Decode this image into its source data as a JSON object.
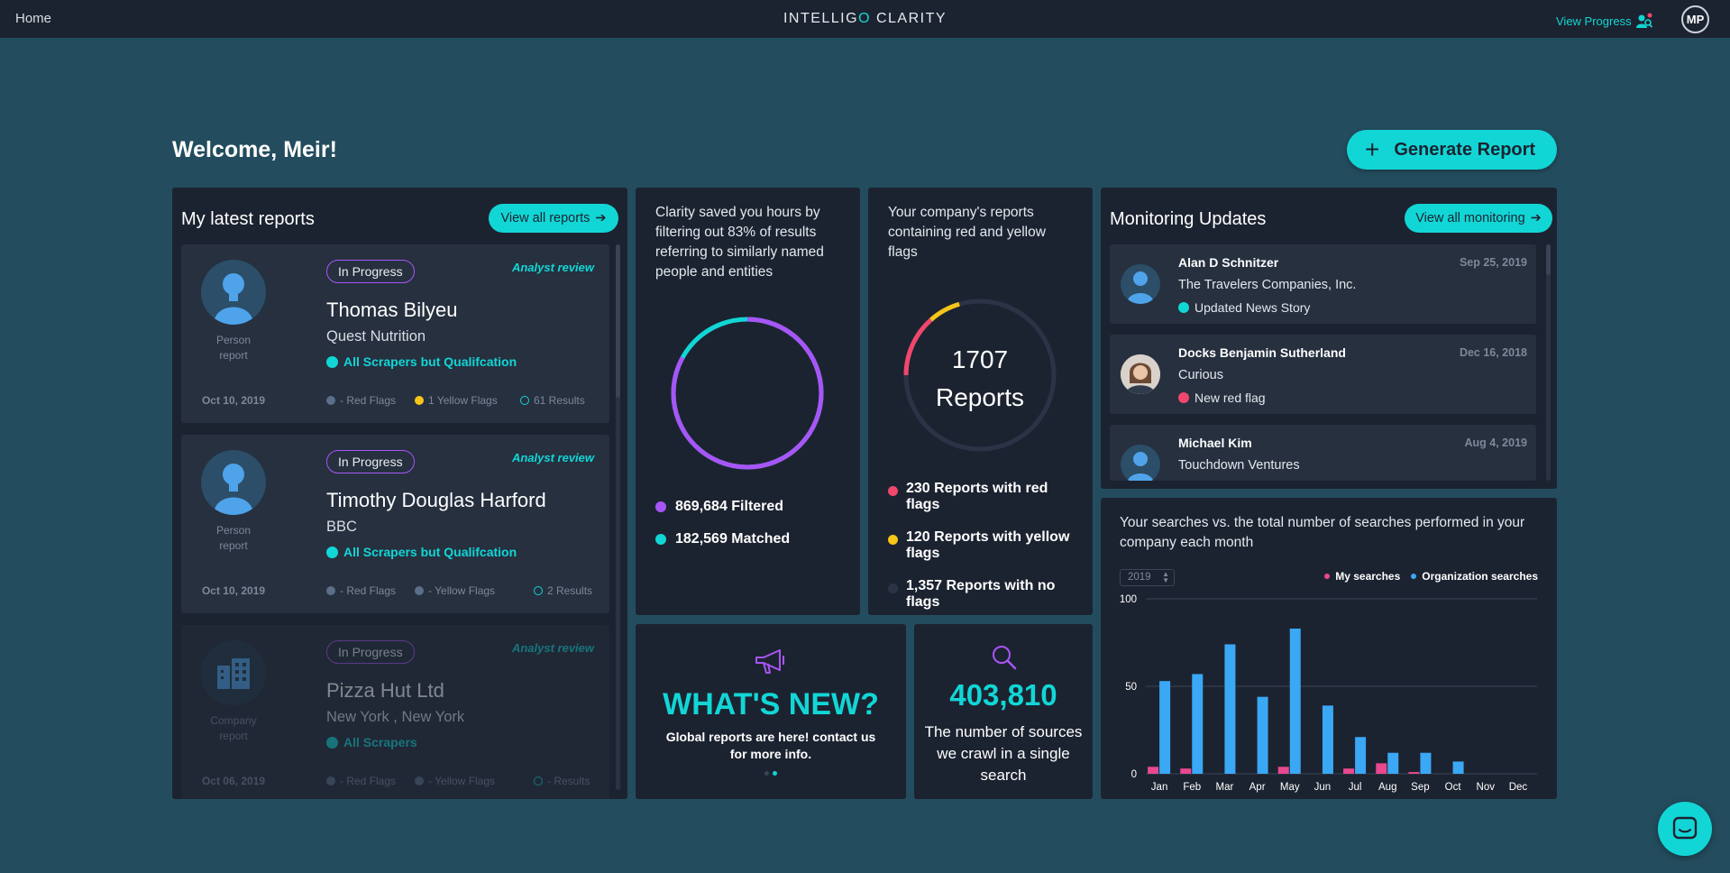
{
  "topbar": {
    "home": "Home",
    "brand_left": "INTELLIG",
    "brand_accent": "O",
    "brand_right": " CLARITY",
    "view_progress": "View Progress",
    "avatar_initials": "MP"
  },
  "welcome": "Welcome, Meir!",
  "generate_button": "Generate Report",
  "reports": {
    "title": "My latest reports",
    "view_all": "View all reports",
    "items": [
      {
        "status": "In Progress",
        "review": "Analyst review",
        "name": "Thomas Bilyeu",
        "company": "Quest Nutrition",
        "scraper": "All Scrapers but Qualifcation",
        "type_line1": "Person",
        "type_line2": "report",
        "date": "Oct 10, 2019",
        "red": "- Red Flags",
        "yellow": "1 Yellow Flags",
        "results": "61 Results"
      },
      {
        "status": "In Progress",
        "review": "Analyst review",
        "name": "Timothy Douglas Harford",
        "company": "BBC",
        "scraper": "All Scrapers but Qualifcation",
        "type_line1": "Person",
        "type_line2": "report",
        "date": "Oct 10, 2019",
        "red": "- Red Flags",
        "yellow": "- Yellow Flags",
        "results": "2 Results"
      },
      {
        "status": "In Progress",
        "review": "Analyst review",
        "name": "Pizza Hut Ltd",
        "company": "New York , New York",
        "scraper": "All Scrapers",
        "type_line1": "Company",
        "type_line2": "report",
        "date": "Oct 06, 2019",
        "red": "- Red Flags",
        "yellow": "- Yellow Flags",
        "results": "- Results"
      }
    ]
  },
  "saved": {
    "text": "Clarity saved you hours by filtering out 83% of results referring to similarly named people and entities",
    "filtered_pct": 83,
    "filtered": "869,684 Filtered",
    "matched": "182,569 Matched",
    "colors": {
      "filtered": "#a855f7",
      "matched": "#12d6d6"
    }
  },
  "flags": {
    "text": "Your company's reports containing red and yellow flags",
    "total": "1707",
    "total_label": "Reports",
    "red_count": 230,
    "yellow_count": 120,
    "none_count": 1357,
    "red_line1": "230 Reports with red",
    "red_line2": "flags",
    "yellow_line1": "120 Reports with yellow",
    "yellow_line2": "flags",
    "none_line1": "1,357 Reports with no",
    "none_line2": "flags",
    "colors": {
      "red": "#f0476d",
      "yellow": "#f5c518",
      "none": "#2a3446"
    }
  },
  "monitoring": {
    "title": "Monitoring Updates",
    "view_all": "View all monitoring",
    "items": [
      {
        "name": "Alan D Schnitzer",
        "date": "Sep 25, 2019",
        "sub": "The Travelers Companies, Inc.",
        "update": "Updated News Story",
        "update_icon": "news-icon"
      },
      {
        "name": "Docks Benjamin Sutherland",
        "date": "Dec 16, 2018",
        "sub": "Curious",
        "update": "New red flag",
        "update_icon": "flag-icon"
      },
      {
        "name": "Michael Kim",
        "date": "Aug 4, 2019",
        "sub": "Touchdown Ventures",
        "update": "",
        "update_icon": ""
      }
    ]
  },
  "whatsnew": {
    "title": "WHAT'S NEW?",
    "text": "Global reports are here! contact us for more info."
  },
  "sources": {
    "number": "403,810",
    "text": "The number of sources we crawl in a single search"
  },
  "searches": {
    "title": "Your searches vs. the total number of searches performed in your company each month",
    "year": "2019",
    "legend_mine": "My searches",
    "legend_org": "Organization searches"
  },
  "chart_data": {
    "type": "bar",
    "title": "Your searches vs. the total number of searches performed in your company each month",
    "categories": [
      "Jan",
      "Feb",
      "Mar",
      "Apr",
      "May",
      "Jun",
      "Jul",
      "Aug",
      "Sep",
      "Oct",
      "Nov",
      "Dec"
    ],
    "series": [
      {
        "name": "My searches",
        "color": "#e8488f",
        "values": [
          4,
          3,
          0,
          0,
          4,
          0,
          3,
          6,
          1,
          0,
          0,
          0
        ]
      },
      {
        "name": "Organization searches",
        "color": "#3aa8f5",
        "values": [
          53,
          57,
          74,
          44,
          83,
          39,
          21,
          12,
          12,
          7,
          0,
          0
        ]
      }
    ],
    "yticks": [
      0,
      50,
      100
    ],
    "ylim": [
      0,
      100
    ],
    "grid": true,
    "legend": "top-right"
  }
}
